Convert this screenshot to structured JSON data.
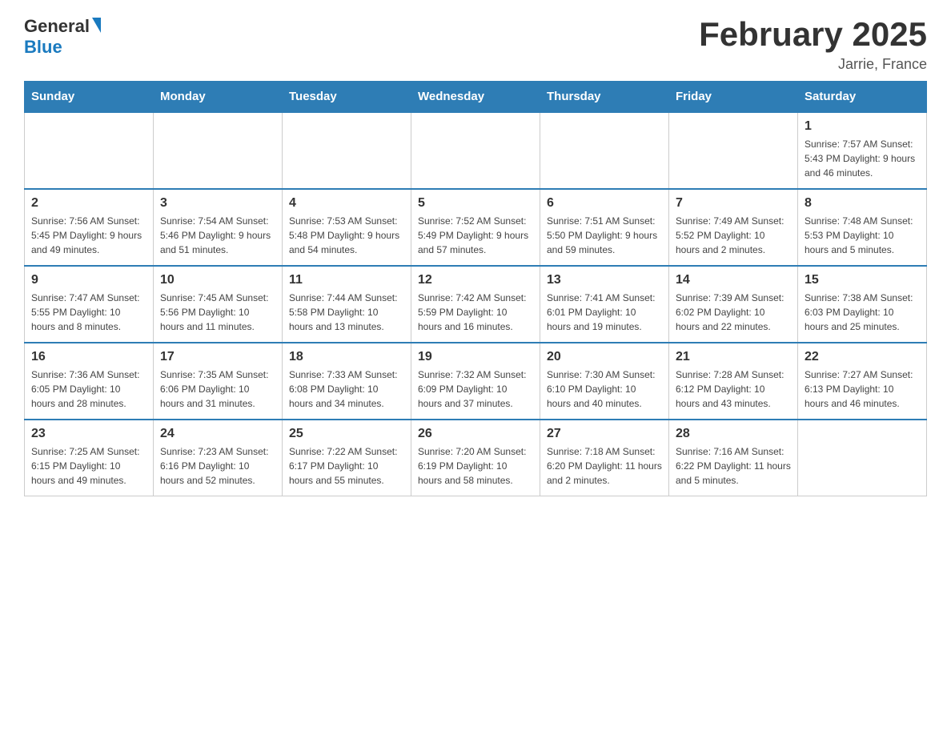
{
  "header": {
    "logo": {
      "general": "General",
      "blue": "Blue"
    },
    "title": "February 2025",
    "location": "Jarrie, France"
  },
  "days_of_week": [
    "Sunday",
    "Monday",
    "Tuesday",
    "Wednesday",
    "Thursday",
    "Friday",
    "Saturday"
  ],
  "weeks": [
    {
      "cells": [
        {
          "day": "",
          "info": ""
        },
        {
          "day": "",
          "info": ""
        },
        {
          "day": "",
          "info": ""
        },
        {
          "day": "",
          "info": ""
        },
        {
          "day": "",
          "info": ""
        },
        {
          "day": "",
          "info": ""
        },
        {
          "day": "1",
          "info": "Sunrise: 7:57 AM\nSunset: 5:43 PM\nDaylight: 9 hours\nand 46 minutes."
        }
      ]
    },
    {
      "cells": [
        {
          "day": "2",
          "info": "Sunrise: 7:56 AM\nSunset: 5:45 PM\nDaylight: 9 hours\nand 49 minutes."
        },
        {
          "day": "3",
          "info": "Sunrise: 7:54 AM\nSunset: 5:46 PM\nDaylight: 9 hours\nand 51 minutes."
        },
        {
          "day": "4",
          "info": "Sunrise: 7:53 AM\nSunset: 5:48 PM\nDaylight: 9 hours\nand 54 minutes."
        },
        {
          "day": "5",
          "info": "Sunrise: 7:52 AM\nSunset: 5:49 PM\nDaylight: 9 hours\nand 57 minutes."
        },
        {
          "day": "6",
          "info": "Sunrise: 7:51 AM\nSunset: 5:50 PM\nDaylight: 9 hours\nand 59 minutes."
        },
        {
          "day": "7",
          "info": "Sunrise: 7:49 AM\nSunset: 5:52 PM\nDaylight: 10 hours\nand 2 minutes."
        },
        {
          "day": "8",
          "info": "Sunrise: 7:48 AM\nSunset: 5:53 PM\nDaylight: 10 hours\nand 5 minutes."
        }
      ]
    },
    {
      "cells": [
        {
          "day": "9",
          "info": "Sunrise: 7:47 AM\nSunset: 5:55 PM\nDaylight: 10 hours\nand 8 minutes."
        },
        {
          "day": "10",
          "info": "Sunrise: 7:45 AM\nSunset: 5:56 PM\nDaylight: 10 hours\nand 11 minutes."
        },
        {
          "day": "11",
          "info": "Sunrise: 7:44 AM\nSunset: 5:58 PM\nDaylight: 10 hours\nand 13 minutes."
        },
        {
          "day": "12",
          "info": "Sunrise: 7:42 AM\nSunset: 5:59 PM\nDaylight: 10 hours\nand 16 minutes."
        },
        {
          "day": "13",
          "info": "Sunrise: 7:41 AM\nSunset: 6:01 PM\nDaylight: 10 hours\nand 19 minutes."
        },
        {
          "day": "14",
          "info": "Sunrise: 7:39 AM\nSunset: 6:02 PM\nDaylight: 10 hours\nand 22 minutes."
        },
        {
          "day": "15",
          "info": "Sunrise: 7:38 AM\nSunset: 6:03 PM\nDaylight: 10 hours\nand 25 minutes."
        }
      ]
    },
    {
      "cells": [
        {
          "day": "16",
          "info": "Sunrise: 7:36 AM\nSunset: 6:05 PM\nDaylight: 10 hours\nand 28 minutes."
        },
        {
          "day": "17",
          "info": "Sunrise: 7:35 AM\nSunset: 6:06 PM\nDaylight: 10 hours\nand 31 minutes."
        },
        {
          "day": "18",
          "info": "Sunrise: 7:33 AM\nSunset: 6:08 PM\nDaylight: 10 hours\nand 34 minutes."
        },
        {
          "day": "19",
          "info": "Sunrise: 7:32 AM\nSunset: 6:09 PM\nDaylight: 10 hours\nand 37 minutes."
        },
        {
          "day": "20",
          "info": "Sunrise: 7:30 AM\nSunset: 6:10 PM\nDaylight: 10 hours\nand 40 minutes."
        },
        {
          "day": "21",
          "info": "Sunrise: 7:28 AM\nSunset: 6:12 PM\nDaylight: 10 hours\nand 43 minutes."
        },
        {
          "day": "22",
          "info": "Sunrise: 7:27 AM\nSunset: 6:13 PM\nDaylight: 10 hours\nand 46 minutes."
        }
      ]
    },
    {
      "cells": [
        {
          "day": "23",
          "info": "Sunrise: 7:25 AM\nSunset: 6:15 PM\nDaylight: 10 hours\nand 49 minutes."
        },
        {
          "day": "24",
          "info": "Sunrise: 7:23 AM\nSunset: 6:16 PM\nDaylight: 10 hours\nand 52 minutes."
        },
        {
          "day": "25",
          "info": "Sunrise: 7:22 AM\nSunset: 6:17 PM\nDaylight: 10 hours\nand 55 minutes."
        },
        {
          "day": "26",
          "info": "Sunrise: 7:20 AM\nSunset: 6:19 PM\nDaylight: 10 hours\nand 58 minutes."
        },
        {
          "day": "27",
          "info": "Sunrise: 7:18 AM\nSunset: 6:20 PM\nDaylight: 11 hours\nand 2 minutes."
        },
        {
          "day": "28",
          "info": "Sunrise: 7:16 AM\nSunset: 6:22 PM\nDaylight: 11 hours\nand 5 minutes."
        },
        {
          "day": "",
          "info": ""
        }
      ]
    }
  ]
}
